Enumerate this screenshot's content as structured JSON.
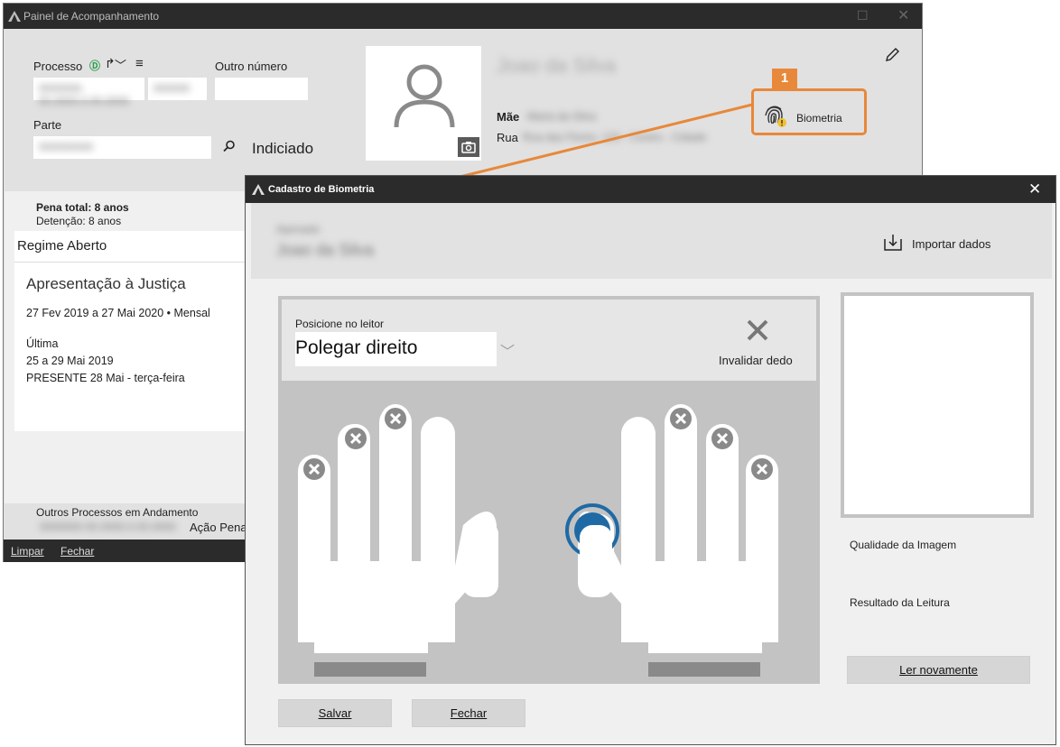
{
  "main_window": {
    "title": "Painel de Acompanhamento",
    "processo_label": "Processo",
    "outro_numero_label": "Outro número",
    "parte_label": "Parte",
    "processo_value": "0000000-00.0000.0.00.0000",
    "processo_value2": "000000",
    "parte_value": "000000000",
    "indiciado_label": "Indiciado",
    "person_name": "Joao da Silva",
    "mae_label": "Mãe",
    "mae_value": "Maria da Silva",
    "rua_label": "Rua",
    "rua_value": "Rua das Flores, 123 - Centro - Cidade",
    "biometria_label": "Biometria",
    "pena_total": "Pena total: 8 anos",
    "detencao": "Detenção: 8 anos",
    "regime": "Regime Aberto",
    "apresentacao_title": "Apresentação à Justiça",
    "apresentacao_periodo": "27 Fev 2019 a 27 Mai 2020 • Mensal",
    "ultima_label": "Última",
    "ultima_periodo": "25 a 29 Mai 2019",
    "presente": "PRESENTE 28 Mai - terça-feira",
    "outros_processos_label": "Outros Processos em Andamento",
    "outros_processo_num": "0000000-00.0000.0.00.0000",
    "acao_penal": "Ação Penal",
    "limpar": "Limpar",
    "fechar": "Fechar"
  },
  "callout": {
    "number": "1"
  },
  "dialog": {
    "title": "Cadastro de Biometria",
    "header_label": "Apenado",
    "header_name": "Joao da Silva",
    "importar_dados": "Importar dados",
    "posicione_label": "Posicione no leitor",
    "finger_selected": "Polegar direito",
    "invalidar_dedo": "Invalidar dedo",
    "qualidade_imagem": "Qualidade da Imagem",
    "resultado_leitura": "Resultado da Leitura",
    "ler_novamente": "Ler novamente",
    "salvar": "Salvar",
    "fechar": "Fechar"
  },
  "colors": {
    "accent_orange": "#e8883a",
    "active_blue": "#1f6aa5",
    "titlebar": "#2b2b2b",
    "panel_gray": "#c3c3c3"
  }
}
